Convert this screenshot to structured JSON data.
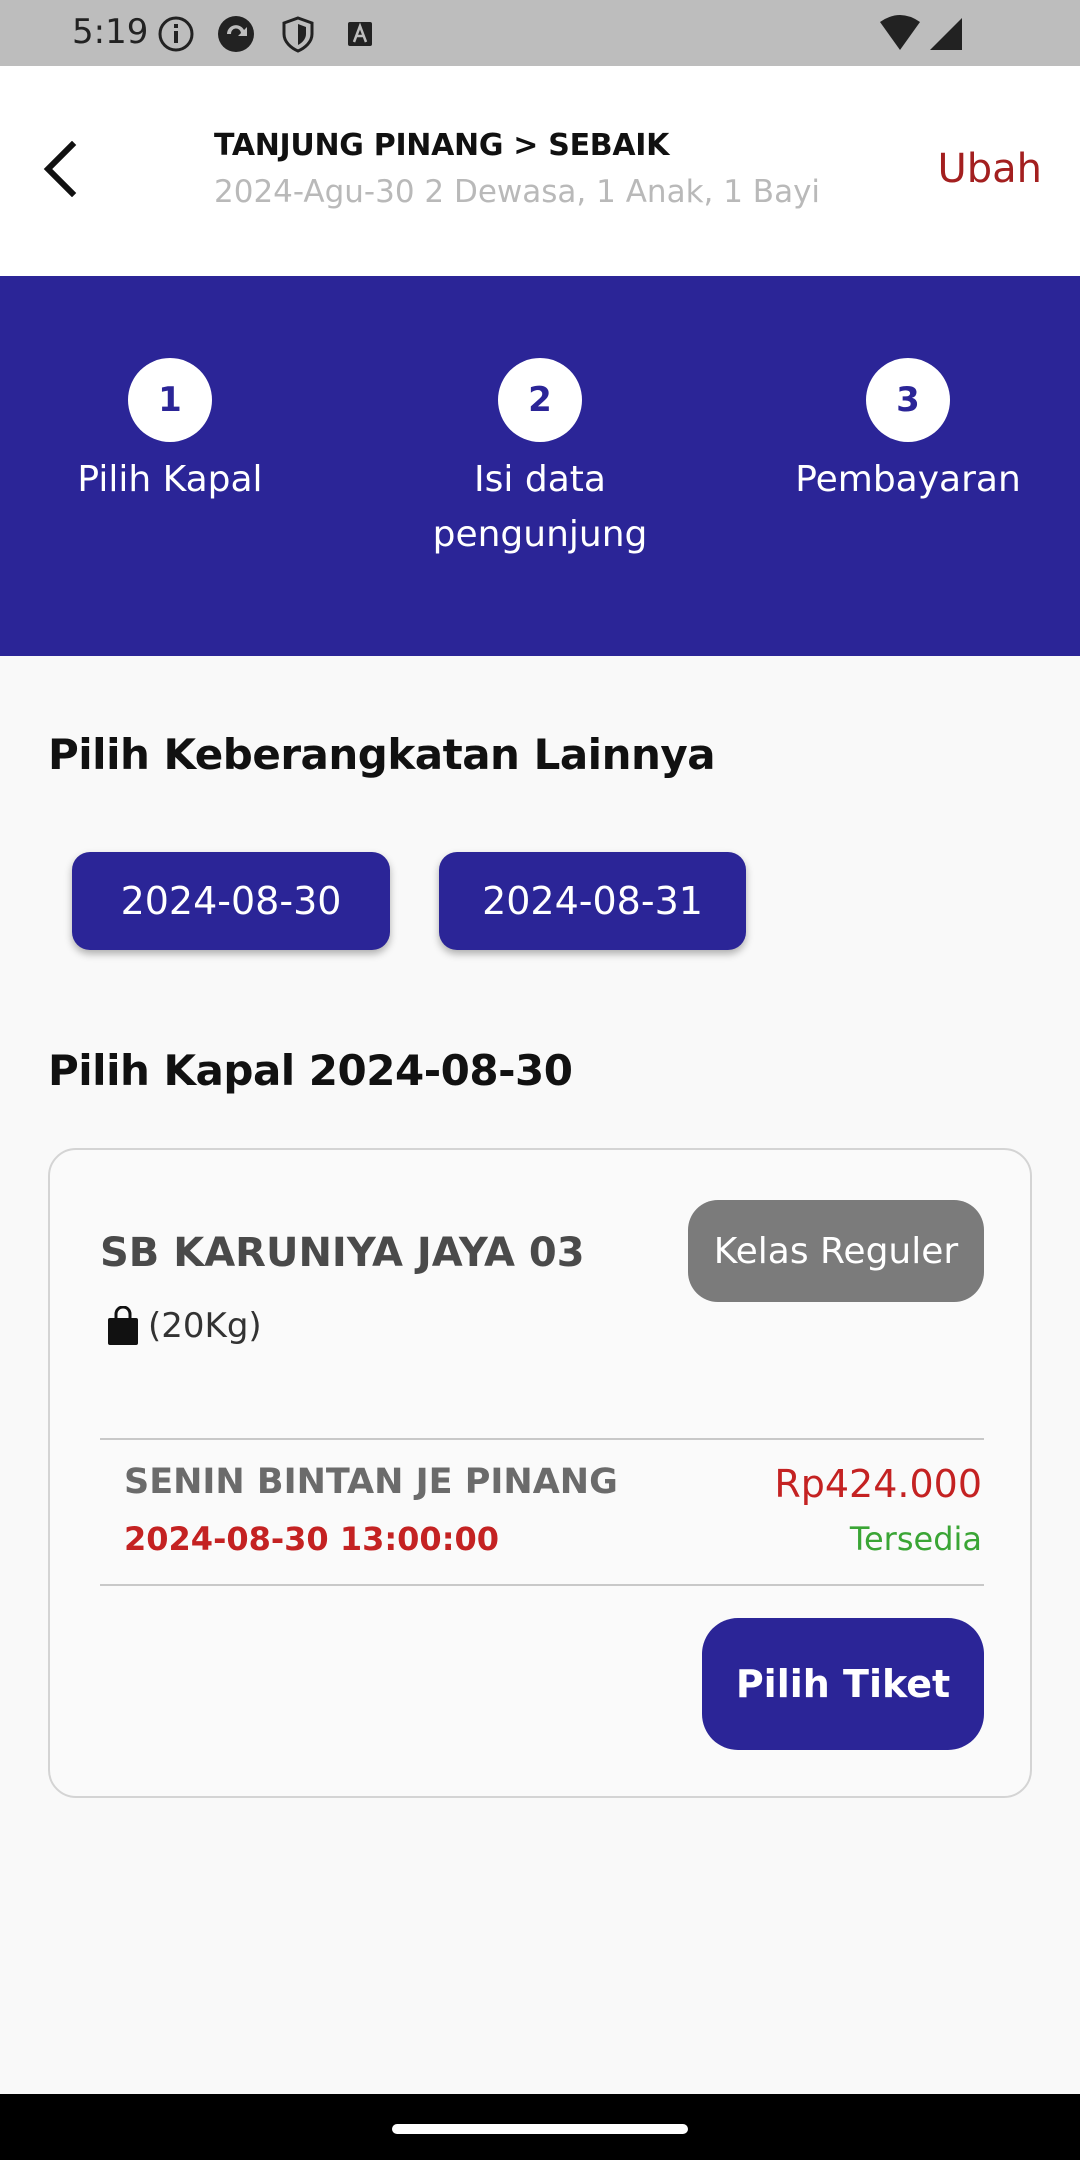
{
  "status_bar": {
    "time": "5:19"
  },
  "header": {
    "route": "TANJUNG PINANG > SEBAIK",
    "summary": "2024-Agu-30 2 Dewasa, 1 Anak, 1 Bayi",
    "edit_label": "Ubah"
  },
  "steps": [
    {
      "number": "1",
      "label": "Pilih Kapal"
    },
    {
      "number": "2",
      "label": "Isi data pengunjung"
    },
    {
      "number": "3",
      "label": "Pembayaran"
    }
  ],
  "other_departures": {
    "title": "Pilih Keberangkatan Lainnya",
    "dates": [
      "2024-08-30",
      "2024-08-31"
    ]
  },
  "ship_section": {
    "title": "Pilih Kapal 2024-08-30",
    "ship": {
      "name": "SB KARUNIYA JAYA 03",
      "class": "Kelas Reguler",
      "baggage": "(20Kg)",
      "route": "SENIN BINTAN JE PINANG",
      "departure": "2024-08-30 13:00:00",
      "price": "Rp424.000",
      "availability": "Tersedia",
      "select_label": "Pilih Tiket"
    }
  },
  "colors": {
    "primary": "#2b2597",
    "accent_red": "#c42222",
    "available_green": "#3aa535",
    "badge_gray": "#7b7b7b"
  }
}
